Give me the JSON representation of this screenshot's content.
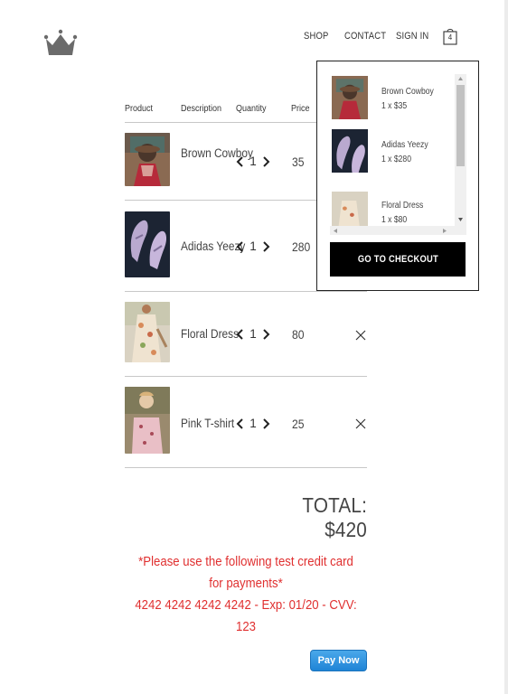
{
  "header": {
    "nav": [
      "SHOP",
      "CONTACT",
      "SIGN IN"
    ],
    "cart_count": "4"
  },
  "table": {
    "columns": [
      "Product",
      "Description",
      "Quantity",
      "Price"
    ],
    "rows": [
      {
        "description": "Brown Cowboy",
        "quantity": "1",
        "price": "35",
        "image": "brown-cowboy-photo"
      },
      {
        "description": "Adidas Yeezy",
        "quantity": "1",
        "price": "280",
        "image": "sneakers-photo"
      },
      {
        "description": "Floral Dress",
        "quantity": "1",
        "price": "80",
        "image": "floral-dress-photo"
      },
      {
        "description": "Pink T-shirt",
        "quantity": "1",
        "price": "25",
        "image": "pink-tshirt-photo"
      }
    ]
  },
  "total": "TOTAL: $420",
  "note": {
    "line1": "*Please use the following test credit card for payments*",
    "line2": "4242 4242 4242 4242 - Exp: 01/20 - CVV: 123"
  },
  "pay_button": "Pay Now",
  "cart_dropdown": {
    "items": [
      {
        "name": "Brown Cowboy",
        "qty": "1 x $35"
      },
      {
        "name": "Adidas Yeezy",
        "qty": "1 x $280"
      },
      {
        "name": "Floral Dress",
        "qty": "1 x $80"
      }
    ],
    "checkout_label": "GO TO CHECKOUT"
  },
  "colors": {
    "note_red": "#e03030",
    "pay_blue": "#2a8fe0",
    "checkout_black": "#000000"
  }
}
